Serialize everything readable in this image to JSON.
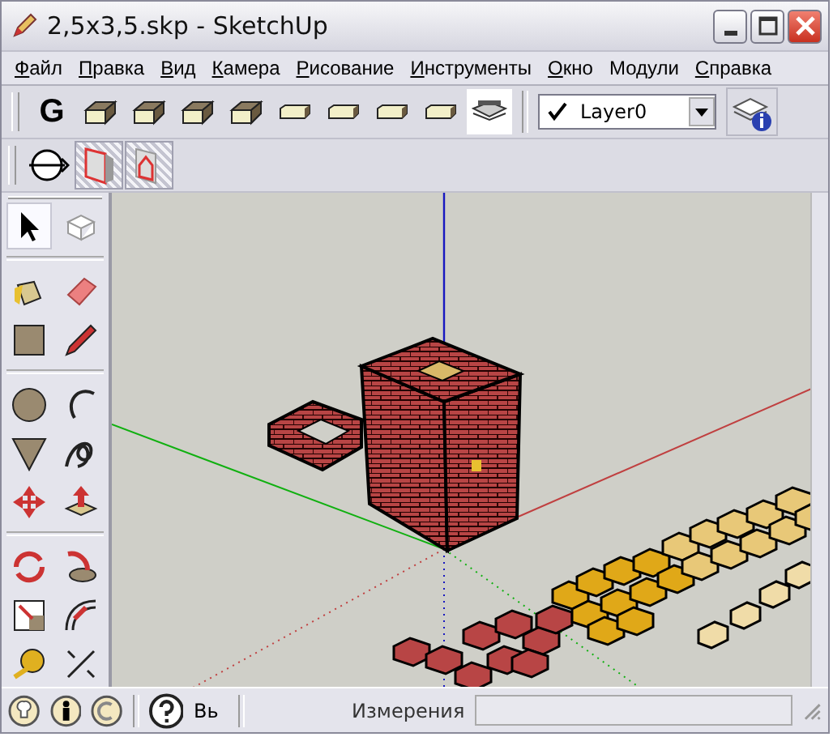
{
  "window": {
    "title": "2,5x3,5.skp - SketchUp"
  },
  "menu": [
    {
      "label": "Файл",
      "mnemonic": true
    },
    {
      "label": "Правка",
      "mnemonic": true
    },
    {
      "label": "Вид",
      "mnemonic": true
    },
    {
      "label": "Камера",
      "mnemonic": true
    },
    {
      "label": "Рисование",
      "mnemonic": true
    },
    {
      "label": "Инструменты",
      "mnemonic": true
    },
    {
      "label": "Окно",
      "mnemonic": true
    },
    {
      "label": "Модули",
      "mnemonic": false
    },
    {
      "label": "Справка",
      "mnemonic": true
    }
  ],
  "toolbar": {
    "group_button": "G",
    "layer": {
      "value": "Layer0",
      "checked": true
    }
  },
  "view_toolbar": [
    {
      "selected": true
    },
    {
      "selected": true
    }
  ],
  "tools": [
    {
      "selected": true
    },
    {
      "selected": false
    },
    {
      "selected": false
    },
    {
      "selected": false
    },
    {
      "selected": false
    },
    {
      "selected": false
    },
    {
      "selected": false
    },
    {
      "selected": false
    },
    {
      "selected": false
    },
    {
      "selected": false
    },
    {
      "selected": false
    },
    {
      "selected": false
    },
    {
      "selected": false
    },
    {
      "selected": false
    },
    {
      "selected": false
    },
    {
      "selected": false
    },
    {
      "selected": false
    },
    {
      "selected": false
    }
  ],
  "status_bar": {
    "hint": "Вь",
    "measurement_label": "Измерения"
  }
}
